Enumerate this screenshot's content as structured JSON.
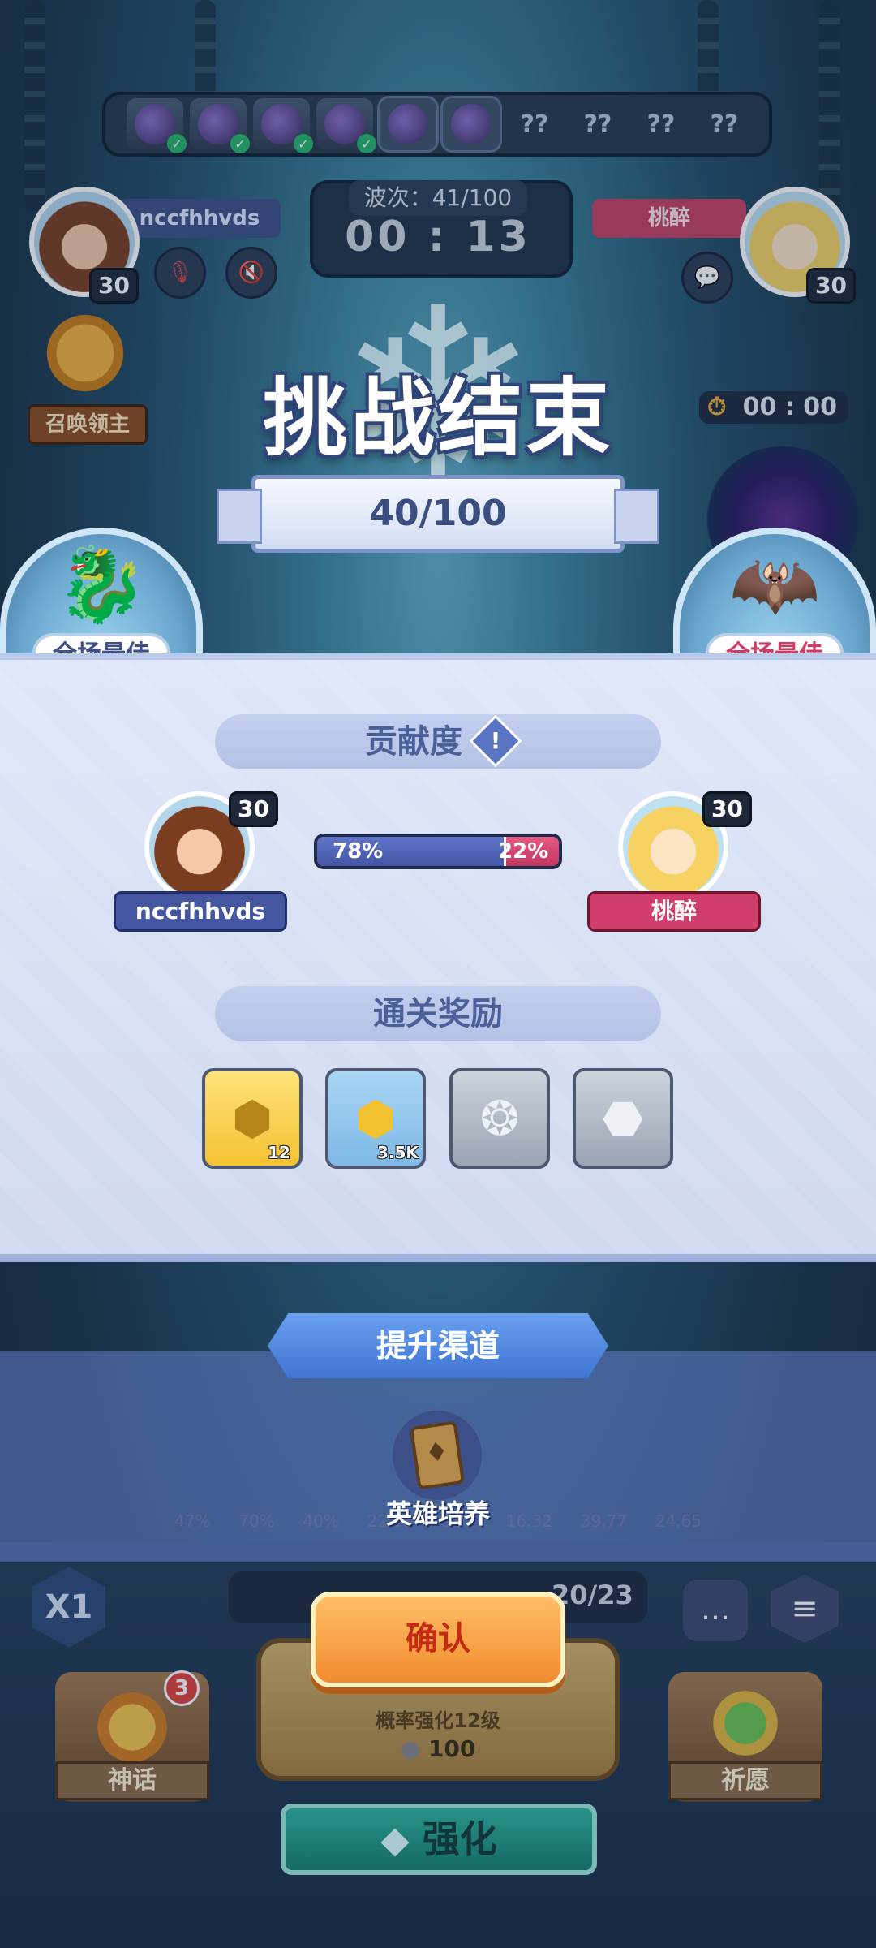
{
  "top": {
    "wave_slots": [
      {
        "state": "done",
        "icon": "boss-portrait-icon"
      },
      {
        "state": "done",
        "icon": "boss-portrait-icon"
      },
      {
        "state": "done",
        "icon": "boss-portrait-icon"
      },
      {
        "state": "done",
        "icon": "boss-portrait-icon"
      },
      {
        "state": "current",
        "icon": "boss-portrait-icon"
      },
      {
        "state": "current",
        "icon": "boss-portrait-icon"
      },
      {
        "state": "locked",
        "icon": "question-icon",
        "text": "??"
      },
      {
        "state": "locked",
        "icon": "question-icon",
        "text": "??"
      },
      {
        "state": "locked",
        "icon": "question-icon",
        "text": "??"
      },
      {
        "state": "locked",
        "icon": "question-icon",
        "text": "??"
      }
    ],
    "wave_label": "波次：41/100",
    "timer": "00 : 13",
    "player1": {
      "name": "nccfhhvds",
      "level": "30"
    },
    "player2": {
      "name": "桃醉",
      "level": "30"
    },
    "summon_lord_label": "召唤领主",
    "stopwatch": "00 : 00"
  },
  "result": {
    "title": "挑战结束",
    "score": "40/100",
    "mvp_label": "全场最佳"
  },
  "contribution": {
    "header": "贡献度",
    "info_icon": "!",
    "player1": {
      "name": "nccfhhvds",
      "level": "30",
      "percent": "78%",
      "share": 0.78
    },
    "player2": {
      "name": "桃醉",
      "level": "30",
      "percent": "22%",
      "share": 0.22
    }
  },
  "rewards": {
    "header": "通关奖励",
    "items": [
      {
        "icon": "key-icon",
        "count": "12",
        "color": "#f4c232"
      },
      {
        "icon": "gold-coin-icon",
        "count": "3.5K",
        "color": "#7fb8e6"
      },
      {
        "icon": "silver-emblem-icon",
        "count": "",
        "color": "#9aa4b4"
      },
      {
        "icon": "silver-badge-icon",
        "count": "",
        "color": "#9aa4b4"
      }
    ]
  },
  "upgrade": {
    "header": "提升渠道",
    "hero_label": "英雄培养"
  },
  "bottom": {
    "stats": [
      "47%",
      "70%",
      "40%",
      "22.58",
      "98.4",
      "16.32",
      "39.77",
      "24.65"
    ],
    "speed": "X1",
    "resource_count": "20/23",
    "confirm": "确认",
    "summon_sub": "概率强化12级",
    "summon_cost": "100",
    "myth_label": "神话",
    "myth_badge": "3",
    "pray_label": "祈愿",
    "enhance_label": "强化"
  }
}
